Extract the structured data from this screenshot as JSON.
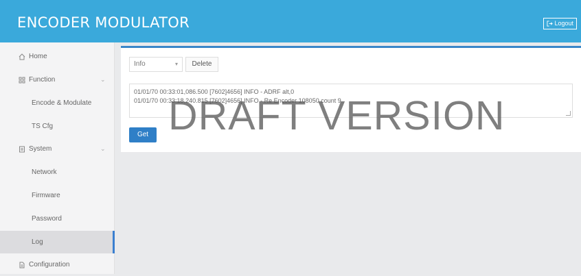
{
  "header": {
    "title": "ENCODER MODULATOR",
    "logout_label": "Logout"
  },
  "sidebar": {
    "items": [
      {
        "label": "Home",
        "icon": "home-icon"
      },
      {
        "label": "Function",
        "icon": "grid-icon"
      },
      {
        "label": "Encode & Modulate"
      },
      {
        "label": "TS Cfg"
      },
      {
        "label": "System",
        "icon": "system-icon"
      },
      {
        "label": "Network"
      },
      {
        "label": "Firmware"
      },
      {
        "label": "Password"
      },
      {
        "label": "Log",
        "active": true
      },
      {
        "label": "Configuration",
        "icon": "document-icon"
      }
    ]
  },
  "log_panel": {
    "level_select": "Info",
    "delete_label": "Delete",
    "lines": [
      "01/01/70 00:33:01,086.500 [7602]4656] INFO - ADRF alt,0",
      "01/01/70 00:33:18,240.815 [7602]4656] INFO - Re Encoder 108050 count 9"
    ],
    "get_label": "Get"
  },
  "watermark": "DRAFT VERSION",
  "colors": {
    "header": "#3aa9db",
    "accent": "#2f7fc7",
    "active_bar": "#3a7fd0"
  }
}
